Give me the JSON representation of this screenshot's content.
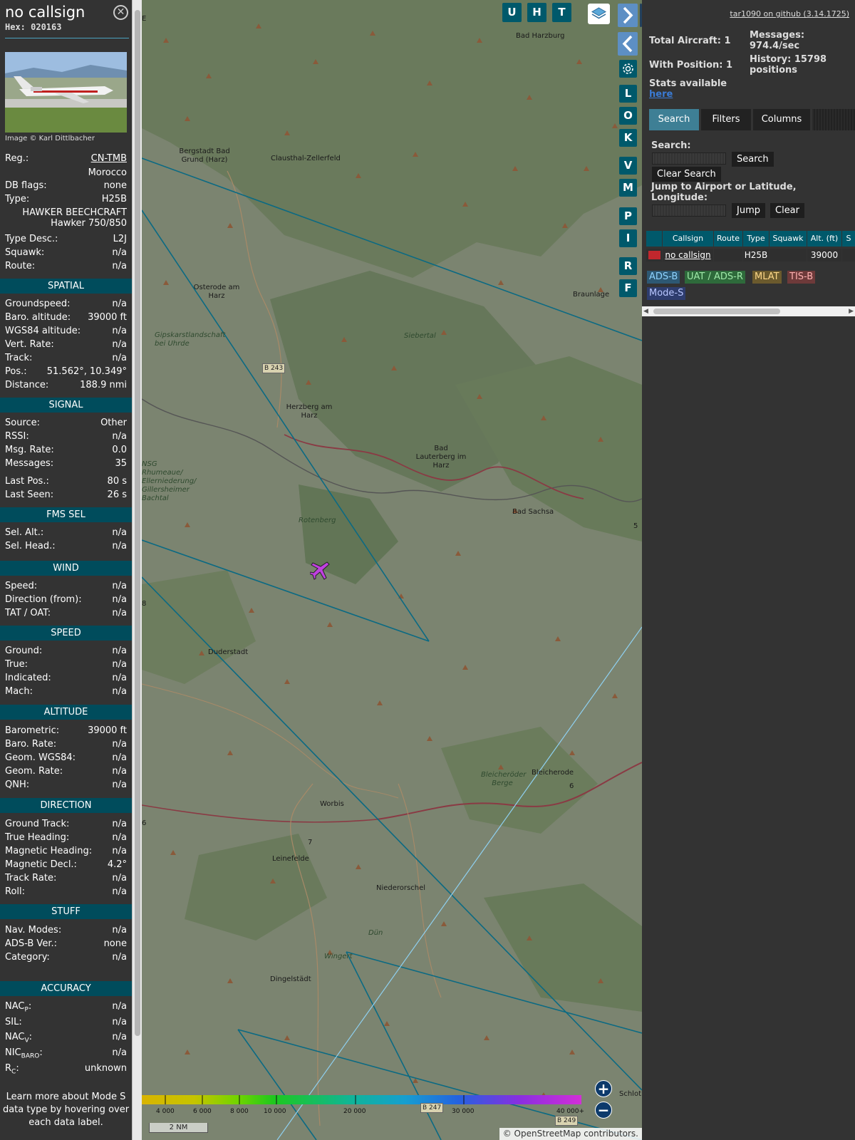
{
  "info": {
    "callsign": "no callsign",
    "hex": "Hex: 020163",
    "photo_credit": "Image © Karl Dittlbacher",
    "reg_label": "Reg.:",
    "reg_value": "CN-TMB",
    "country": "Morocco",
    "dbflags_label": "DB flags:",
    "dbflags_value": "none",
    "type_label": "Type:",
    "type_value": "H25B",
    "type_name_1": "HAWKER BEECHCRAFT",
    "type_name_2": "Hawker 750/850",
    "typedesc_label": "Type Desc.:",
    "typedesc_value": "L2J",
    "squawk_label": "Squawk:",
    "squawk_value": "n/a",
    "route_label": "Route:",
    "route_value": "n/a",
    "spatial": {
      "title": "SPATIAL",
      "rows": [
        {
          "k": "Groundspeed:",
          "v": "n/a"
        },
        {
          "k": "Baro. altitude:",
          "v": "39000 ft"
        },
        {
          "k": "WGS84 altitude:",
          "v": "n/a"
        },
        {
          "k": "Vert. Rate:",
          "v": "n/a"
        },
        {
          "k": "Track:",
          "v": "n/a"
        },
        {
          "k": "Pos.:",
          "v": "51.562°, 10.349°"
        },
        {
          "k": "Distance:",
          "v": "188.9 nmi"
        }
      ]
    },
    "signal": {
      "title": "SIGNAL",
      "rows": [
        {
          "k": "Source:",
          "v": "Other"
        },
        {
          "k": "RSSI:",
          "v": "n/a"
        },
        {
          "k": "Msg. Rate:",
          "v": "0.0"
        },
        {
          "k": "Messages:",
          "v": "35"
        },
        {
          "k": "Last Pos.:",
          "v": "80 s"
        },
        {
          "k": "Last Seen:",
          "v": "26 s"
        }
      ]
    },
    "fms": {
      "title": "FMS SEL",
      "rows": [
        {
          "k": "Sel. Alt.:",
          "v": "n/a"
        },
        {
          "k": "Sel. Head.:",
          "v": "n/a"
        }
      ]
    },
    "wind": {
      "title": "WIND",
      "rows": [
        {
          "k": "Speed:",
          "v": "n/a"
        },
        {
          "k": "Direction (from):",
          "v": "n/a"
        },
        {
          "k": "TAT / OAT:",
          "v": "n/a"
        }
      ]
    },
    "speed": {
      "title": "SPEED",
      "rows": [
        {
          "k": "Ground:",
          "v": "n/a"
        },
        {
          "k": "True:",
          "v": "n/a"
        },
        {
          "k": "Indicated:",
          "v": "n/a"
        },
        {
          "k": "Mach:",
          "v": "n/a"
        }
      ]
    },
    "altitude": {
      "title": "ALTITUDE",
      "rows": [
        {
          "k": "Barometric:",
          "v": "39000 ft"
        },
        {
          "k": "Baro. Rate:",
          "v": "n/a"
        },
        {
          "k": "Geom. WGS84:",
          "v": "n/a"
        },
        {
          "k": "Geom. Rate:",
          "v": "n/a"
        },
        {
          "k": "QNH:",
          "v": "n/a"
        }
      ]
    },
    "direction": {
      "title": "DIRECTION",
      "rows": [
        {
          "k": "Ground Track:",
          "v": "n/a"
        },
        {
          "k": "True Heading:",
          "v": "n/a"
        },
        {
          "k": "Magnetic Heading:",
          "v": "n/a"
        },
        {
          "k": "Magnetic Decl.:",
          "v": "4.2°"
        },
        {
          "k": "Track Rate:",
          "v": "n/a"
        },
        {
          "k": "Roll:",
          "v": "n/a"
        }
      ]
    },
    "stuff": {
      "title": "STUFF",
      "rows": [
        {
          "k": "Nav. Modes:",
          "v": "n/a"
        },
        {
          "k": "ADS-B Ver.:",
          "v": "none"
        },
        {
          "k": "Category:",
          "v": "n/a"
        }
      ]
    },
    "accuracy": {
      "title": "ACCURACY",
      "nacp": "NAC",
      "nacp_sub": "P",
      "nacp_v": "n/a",
      "sil": "SIL:",
      "sil_v": "n/a",
      "nacv": "NAC",
      "nacv_sub": "V",
      "nacv_v": "n/a",
      "nic": "NIC",
      "nic_sub": "BARO",
      "nic_v": "n/a",
      "rc": "R",
      "rc_sub": "C",
      "rc_v": "unknown"
    },
    "footer": "Learn more about Mode S data type by hovering over each data label."
  },
  "map": {
    "buttons_top": [
      "U",
      "H",
      "T"
    ],
    "side_buttons": [
      "L",
      "O",
      "K",
      "V",
      "M",
      "P",
      "I",
      "R",
      "F"
    ],
    "place_labels": [
      "Bad Harzburg",
      "Bergstadt Bad Grund (Harz)",
      "Clausthal-Zellerfeld",
      "Osterode am Harz",
      "Gipskarstlandschaft bei Uhrde",
      "Siebertal",
      "Braunlage",
      "B 243",
      "Herzberg am Harz",
      "Bad Lauterberg im Harz",
      "NSG Rhumeaue/ Ellerniederung/ Gillersheimer Bachtal",
      "Bad Sachsa",
      "Rotenberg",
      "Duderstadt",
      "Bleicheröder Berge",
      "Bleicherode",
      "Worbis",
      "Leinefelde",
      "Niederorschel",
      "Dün",
      "Wingert",
      "Dingelstädt",
      "Schlot",
      "B 247",
      "B 249",
      "n",
      "E",
      "5",
      "8",
      "6",
      "7"
    ],
    "colorbar_labels": [
      "4 000",
      "6 000",
      "8 000",
      "10 000",
      "20 000",
      "30 000",
      "40 000+"
    ],
    "scale": "2 NM",
    "attribution": "© OpenStreetMap contributors.",
    "zoom_in": "+",
    "zoom_out": "−",
    "aircraft_color": "#c040e0"
  },
  "sidebar": {
    "github": "tar1090 on github (3.14.1725)",
    "total_aircraft": "Total Aircraft: 1",
    "with_position": "With Position: 1",
    "messages": "Messages: 974.4/sec",
    "history": "History: 15798 positions",
    "stats_avail": "Stats available",
    "here": "here",
    "tabs": [
      "Search",
      "Filters",
      "Columns"
    ],
    "search_label": "Search:",
    "search_button": "Search",
    "clear_search": "Clear Search",
    "jump_label": "Jump to Airport or Latitude, Longitude:",
    "jump_button": "Jump",
    "clear_button": "Clear",
    "columns": [
      "Callsign",
      "Route",
      "Type",
      "Squawk",
      "Alt. (ft)",
      "S"
    ],
    "row": {
      "callsign": "no callsign",
      "route": "",
      "type": "H25B",
      "squawk": "",
      "alt": "39000"
    },
    "legend": [
      "ADS-B",
      "UAT / ADS-R",
      "MLAT",
      "TIS-B",
      "Mode-S"
    ],
    "legend_colors": [
      "#2d5873",
      "#2e6a3b",
      "#6b5a2d",
      "#6e3a3a",
      "#2e3d6e"
    ]
  }
}
